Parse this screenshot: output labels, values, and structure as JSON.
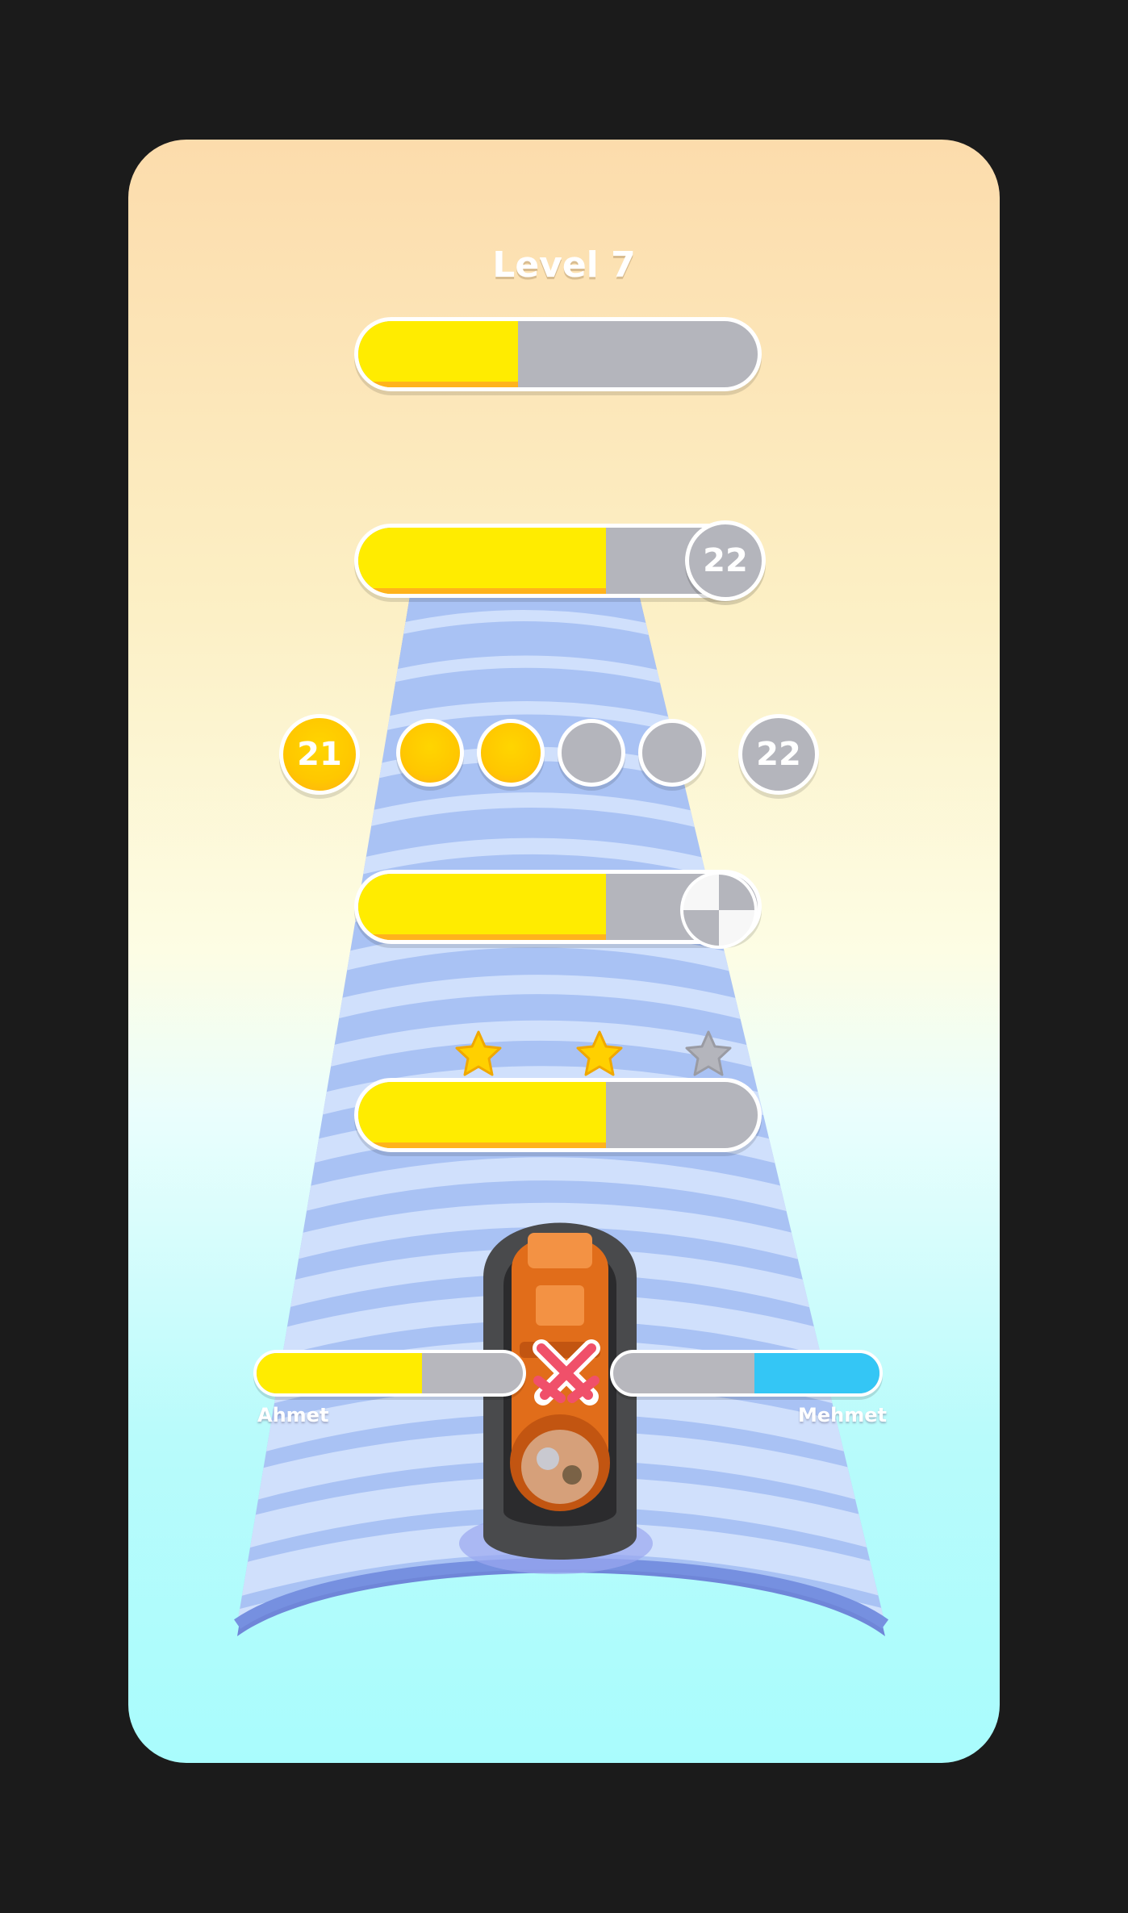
{
  "level": {
    "title": "Level 7"
  },
  "colors": {
    "yellow": "#ffec00",
    "gold": "#ffc700",
    "grey": "#b4b5bc",
    "blue": "#34c6f5",
    "road": "#a9c2f4",
    "vehicle": "#e16d1a"
  },
  "progress_bars": [
    {
      "name": "plain-progress-bar",
      "fill_fraction": 0.4
    },
    {
      "name": "numbered-progress-bar",
      "fill_fraction": 0.62,
      "end_label": "22"
    },
    {
      "name": "checkered-progress-bar",
      "fill_fraction": 0.62,
      "end_icon": "checkered-flag-icon"
    },
    {
      "name": "stars-progress-bar",
      "fill_fraction": 0.62
    }
  ],
  "dot_progress": {
    "start_label": "21",
    "end_label": "22",
    "dots_filled": 2,
    "dots_total": 4
  },
  "stars": {
    "earned": 2,
    "total": 3
  },
  "players": {
    "left": {
      "name": "Ahmet",
      "fill_fraction": 0.62,
      "color": "#ffec00"
    },
    "right": {
      "name": "Mehmet",
      "fill_fraction": 0.47,
      "color": "#34c6f5"
    },
    "versus_icon": "crossed-swords-icon"
  }
}
